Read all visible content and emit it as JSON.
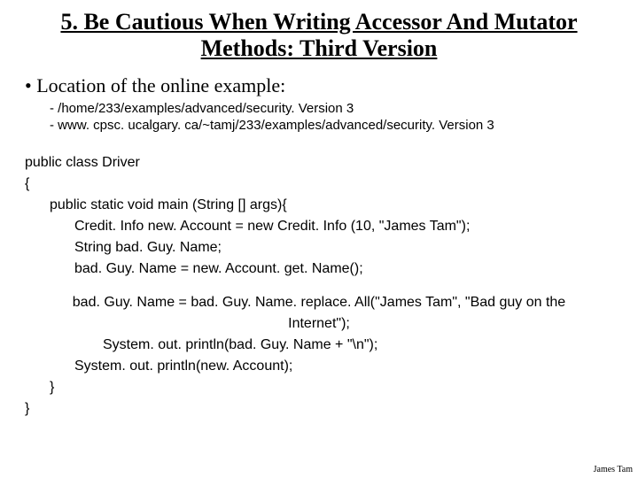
{
  "title": "5. Be Cautious When Writing Accessor And Mutator Methods: Third Version",
  "locationHeading": "Location of the online example:",
  "paths": {
    "local": "/home/233/examples/advanced/security. Version 3",
    "web": "www. cpsc. ucalgary. ca/~tamj/233/examples/advanced/security. Version 3"
  },
  "code": {
    "l1": "public class Driver",
    "l2": "{",
    "l3": "public static void main (String [] args){",
    "l4": "Credit. Info new. Account = new Credit. Info (10, \"James Tam\");",
    "l5": "String bad. Guy. Name;",
    "l6": "bad. Guy. Name = new. Account. get. Name();",
    "l7": "bad. Guy. Name = bad. Guy. Name. replace. All(\"James Tam\", \"Bad guy on the Internet\");",
    "l8": "System. out. println(bad. Guy. Name + \"\\n\");",
    "l9": "System. out. println(new. Account);",
    "l10": "}",
    "l11": "}"
  },
  "footer": "James Tam"
}
